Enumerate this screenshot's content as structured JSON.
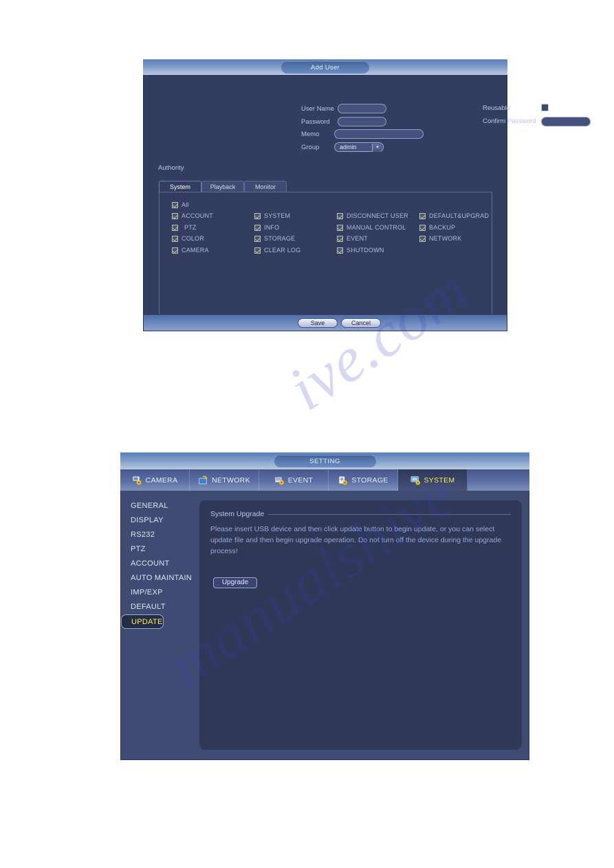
{
  "add_user_dialog": {
    "title": "Add User",
    "fields": {
      "user_name_label": "User Name",
      "user_name_value": "",
      "password_label": "Password",
      "password_value": "",
      "memo_label": "Memo",
      "memo_value": "",
      "group_label": "Group",
      "group_value": "admin",
      "reusable_label": "Reusable",
      "reusable_checked": false,
      "confirm_password_label": "Confirm Password",
      "confirm_password_value": ""
    },
    "authority_label": "Authority",
    "tabs": [
      {
        "label": "System",
        "active": true
      },
      {
        "label": "Playback",
        "active": false
      },
      {
        "label": "Monitor",
        "active": false
      }
    ],
    "permissions": {
      "all": {
        "label": "All",
        "checked": true
      },
      "col1": [
        {
          "label": "ACCOUNT",
          "checked": true
        },
        {
          "label": "PTZ",
          "checked": true
        },
        {
          "label": "COLOR",
          "checked": true
        },
        {
          "label": "CAMERA",
          "checked": true
        }
      ],
      "col2": [
        {
          "label": "SYSTEM",
          "checked": true
        },
        {
          "label": "INFO",
          "checked": true
        },
        {
          "label": "STORAGE",
          "checked": true
        },
        {
          "label": "CLEAR LOG",
          "checked": true
        }
      ],
      "col3": [
        {
          "label": "DISCONNECT USER",
          "checked": true
        },
        {
          "label": "MANUAL CONTROL",
          "checked": true
        },
        {
          "label": "EVENT",
          "checked": true
        },
        {
          "label": "SHUTDOWN",
          "checked": true
        }
      ],
      "col4": [
        {
          "label": "DEFAULT&UPGRAD",
          "checked": true
        },
        {
          "label": "BACKUP",
          "checked": true
        },
        {
          "label": "NETWORK",
          "checked": true
        }
      ]
    },
    "buttons": {
      "save": "Save",
      "cancel": "Cancel"
    }
  },
  "setting_dialog": {
    "title": "SETTING",
    "nav_tabs": [
      {
        "label": "CAMERA",
        "icon": "camera-icon",
        "active": false
      },
      {
        "label": "NETWORK",
        "icon": "network-icon",
        "active": false
      },
      {
        "label": "EVENT",
        "icon": "event-icon",
        "active": false
      },
      {
        "label": "STORAGE",
        "icon": "storage-icon",
        "active": false
      },
      {
        "label": "SYSTEM",
        "icon": "system-icon",
        "active": true
      }
    ],
    "sidebar": [
      {
        "label": "GENERAL",
        "selected": false
      },
      {
        "label": "DISPLAY",
        "selected": false
      },
      {
        "label": "RS232",
        "selected": false
      },
      {
        "label": "PTZ",
        "selected": false
      },
      {
        "label": "ACCOUNT",
        "selected": false
      },
      {
        "label": "AUTO MAINTAIN",
        "selected": false
      },
      {
        "label": "IMP/EXP",
        "selected": false
      },
      {
        "label": "DEFAULT",
        "selected": false
      },
      {
        "label": "UPDATE",
        "selected": true
      }
    ],
    "panel": {
      "section_title": "System Upgrade",
      "description": "Please insert USB device and then click update button to begin update, or you can select update file and then begin upgrade operation. Do not turn off the device during the upgrade process!",
      "upgrade_button": "Upgrade"
    }
  },
  "watermark": {
    "line1": "ive.com",
    "line2": "manualshive"
  },
  "colors": {
    "accent_yellow": "#ffe45c",
    "panel_dark": "#2f3957",
    "dialog_body": "#333d60",
    "label_blue": "#b9c6e8"
  }
}
